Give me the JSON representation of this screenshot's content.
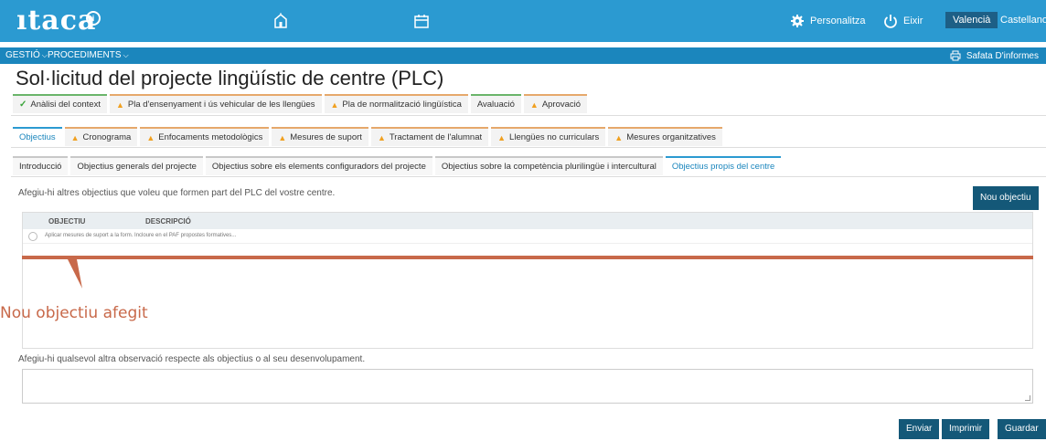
{
  "header": {
    "logo": "ıtaca",
    "logo_mark": "i",
    "personalitza": "Personalitza",
    "eixir": "Eixir",
    "lang_active": "Valencià",
    "lang_other": "Castellano"
  },
  "subnav": {
    "gestio": "GESTIÓ",
    "procediments": "PROCEDIMENTS",
    "reports": "Safata D'informes"
  },
  "page_title": "Sol·licitud del projecte lingüístic de centre (PLC)",
  "tabs_l1": [
    "Anàlisi del context",
    "Pla d'ensenyament i ús vehicular de les llengües",
    "Pla de normalització lingüística",
    "Avaluació",
    "Aprovació"
  ],
  "tabs_l2": [
    "Objectius",
    "Cronograma",
    "Enfocaments metodològics",
    "Mesures de suport",
    "Tractament de l'alumnat",
    "Llengües no curriculars",
    "Mesures organitzatives"
  ],
  "tabs_l3": [
    "Introducció",
    "Objectius generals del projecte",
    "Objectius sobre els elements configuradors del projecte",
    "Objectius sobre la competència plurilingüe i intercultural",
    "Objectius propis del centre"
  ],
  "instruction": "Afegiu-hi altres objectius que voleu que formen part del PLC del vostre centre.",
  "new_objective_button": "Nou objectiu",
  "table": {
    "col_objectiu": "OBJECTIU",
    "col_descripcio": "DESCRIPCIÓ",
    "rows": [
      {
        "text": "Aplicar mesures de suport a la form. Incloure en el PAF propostes formatives..."
      }
    ]
  },
  "annotation": "Nou objectiu afegit",
  "instruction2": "Afegiu-hi qualsevol altra observació respecte als objectius o al seu desenvolupament.",
  "footer_buttons": {
    "enviar": "Enviar",
    "imprimir": "Imprimir",
    "guardar": "Guardar"
  },
  "colors": {
    "header": "#2b9ad1",
    "subnav": "#1b86bd",
    "button": "#145878",
    "annotation": "#c8694a"
  }
}
